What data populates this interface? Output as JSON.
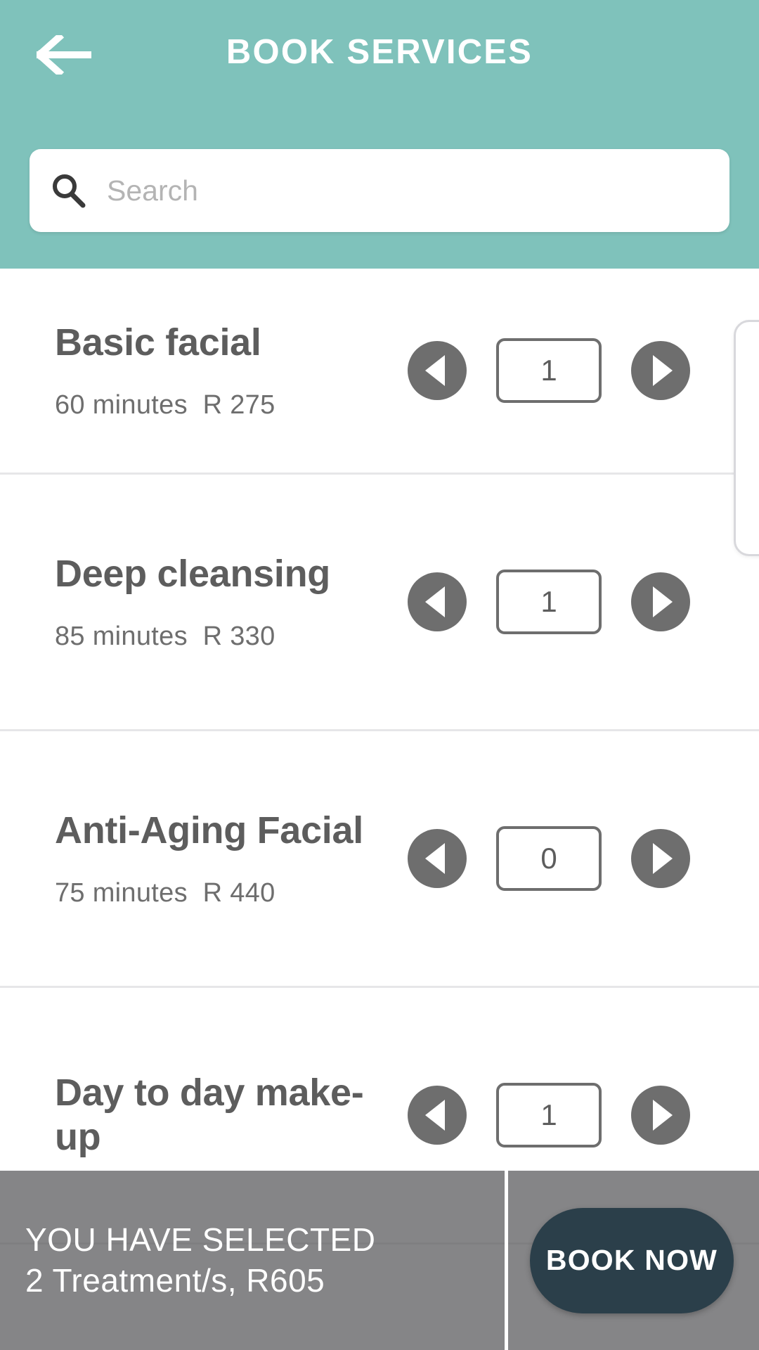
{
  "header": {
    "title": "BOOK SERVICES",
    "back_icon": "arrow-left-icon",
    "background_color": "#7fc2bb"
  },
  "search": {
    "icon": "search-icon",
    "placeholder": "Search",
    "value": ""
  },
  "services": [
    {
      "name": "Basic facial",
      "duration": "60 minutes",
      "price": "R 275",
      "quantity": "1",
      "decrement_icon": "triangle-left-icon",
      "increment_icon": "triangle-right-icon"
    },
    {
      "name": "Deep cleansing",
      "duration": "85 minutes",
      "price": "R 330",
      "quantity": "1",
      "decrement_icon": "triangle-left-icon",
      "increment_icon": "triangle-right-icon"
    },
    {
      "name": "Anti-Aging Facial",
      "duration": "75 minutes",
      "price": "R 440",
      "quantity": "0",
      "decrement_icon": "triangle-left-icon",
      "increment_icon": "triangle-right-icon"
    },
    {
      "name": "Day to day make-up",
      "duration": "",
      "price": "",
      "quantity": "1",
      "decrement_icon": "triangle-left-icon",
      "increment_icon": "triangle-right-icon"
    }
  ],
  "bottom_bar": {
    "selected_label": "YOU HAVE SELECTED",
    "selected_summary": "2 Treatment/s, R605",
    "book_button_label": "BOOK NOW",
    "book_button_color": "#2b3f4a",
    "bar_color": "#5a5a5d"
  }
}
